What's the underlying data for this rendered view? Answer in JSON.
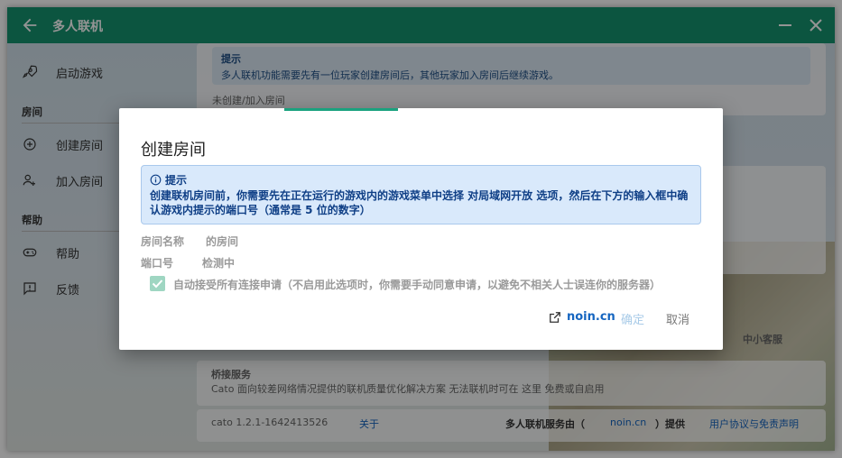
{
  "window": {
    "title": "多人联机"
  },
  "sidebar": {
    "launch_label": "启动游戏",
    "section_room": "房间",
    "create_room_label": "创建房间",
    "join_room_label": "加入房间",
    "section_help": "帮助",
    "help_label": "帮助",
    "feedback_label": "反馈"
  },
  "background": {
    "hint_title": "提示",
    "hint_text": "多人联机功能需要先有一位玩家创建房间后，其他玩家加入房间后继续游戏。",
    "status_label": "未创建/加入房间",
    "bridge_title": "桥接服务",
    "bridge_desc": "Cato 面向较差网络情况提供的联机质量优化解决方案  无法联机时可在 这里 免费或自启用",
    "version": "cato 1.2.1-1642413526",
    "about_link": "关于",
    "provider_prefix": "多人联机服务由（",
    "provider_link": "noin.cn",
    "provider_suffix": "）提供",
    "terms_link": "用户协议与免责声明",
    "right_btn": "中小客服"
  },
  "dialog": {
    "title": "创建房间",
    "hint_title": "提示",
    "hint_text": "创建联机房间前，你需要先在正在运行的游戏内的游戏菜单中选择 对局域网开放 选项，然后在下方的输入框中确认游戏内提示的端口号（通常是 5 位的数字）",
    "room_name_label": "房间名称",
    "room_name_value": "的房间",
    "port_label": "端口号",
    "port_value": "检测中",
    "auto_accept_label": "自动接受所有连接申请（不启用此选项时，你需要手动同意申请，以避免不相关人士误连你的服务器）",
    "auto_accept_checked": true,
    "link_label": "noin.cn",
    "confirm_label": "确定",
    "cancel_label": "取消"
  },
  "colors": {
    "accent": "#15936f",
    "link": "#1565c0",
    "hint_bg": "#d9e9fb"
  }
}
